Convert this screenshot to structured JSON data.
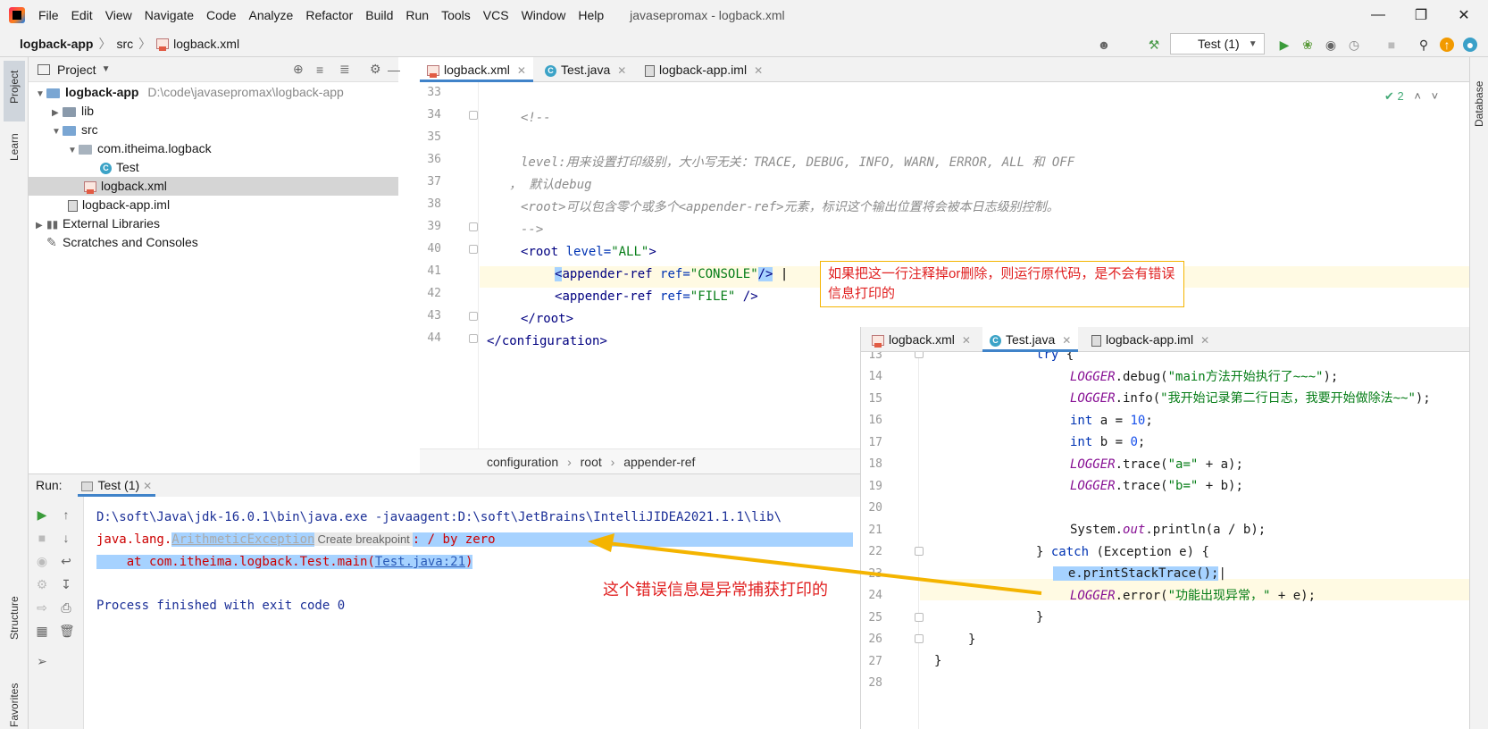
{
  "menubar": {
    "items": [
      "File",
      "Edit",
      "View",
      "Navigate",
      "Code",
      "Analyze",
      "Refactor",
      "Build",
      "Run",
      "Tools",
      "VCS",
      "Window",
      "Help"
    ],
    "title": "javasepromax - logback.xml"
  },
  "navbar": {
    "crumbs": [
      "logback-app",
      "src",
      "logback.xml"
    ],
    "run_config": "Test (1)"
  },
  "left_strip": {
    "project": "Project",
    "learn": "Learn",
    "structure": "Structure",
    "favorites": "Favorites"
  },
  "right_strip": {
    "database": "Database"
  },
  "project": {
    "header": "Project",
    "tree": [
      {
        "label": "logback-app",
        "path": "D:\\code\\javasepromax\\logback-app"
      },
      {
        "label": "lib"
      },
      {
        "label": "src"
      },
      {
        "label": "com.itheima.logback"
      },
      {
        "label": "Test"
      },
      {
        "label": "logback.xml"
      },
      {
        "label": "logback-app.iml"
      },
      {
        "label": "External Libraries"
      },
      {
        "label": "Scratches and Consoles"
      }
    ]
  },
  "editor": {
    "tabs": [
      "logback.xml",
      "Test.java",
      "logback-app.iml"
    ],
    "line_numbers": [
      "33",
      "34",
      "35",
      "36",
      "37",
      "38",
      "39",
      "40",
      "41",
      "42",
      "43",
      "44"
    ],
    "inspection_count": "2",
    "lines": {
      "l34": "<!--",
      "l36a": "level:",
      "l36b": "用来设置打印级别，大小写无关：TRACE, DEBUG, INFO, WARN, ERROR, ALL 和 OFF",
      "l37": "， 默认debug",
      "l38a": "<root>",
      "l38b": "可以包含零个或多个",
      "l38c": "<appender-ref>",
      "l38d": "元素，标识这个输出位置将会被本日志级别控制。",
      "l39": "-->",
      "l40_tag": "root",
      "l40_attr": "level",
      "l40_val": "\"ALL\"",
      "l41_tag": "appender-ref",
      "l41_attr": "ref",
      "l41_val": "\"CONSOLE\"",
      "l42_tag": "appender-ref",
      "l42_attr": "ref",
      "l42_val": "\"FILE\"",
      "l43_tag": "root",
      "l44_tag": "configuration"
    },
    "breadcrumbs": [
      "configuration",
      "root",
      "appender-ref"
    ]
  },
  "note_box": "如果把这一行注释掉or删除，则运行原代码，是不会有错误信息打印的",
  "run": {
    "label": "Run:",
    "tab": "Test (1)",
    "lines": {
      "cmd": "D:\\soft\\Java\\jdk-16.0.1\\bin\\java.exe -javaagent:D:\\soft\\JetBrains\\IntelliJIDEA2021.1.1\\lib\\",
      "exc_prefix": "java.lang.",
      "exc_class": "ArithmeticException",
      "bp_chip": "Create breakpoint",
      "exc_msg": ": / by zero",
      "at_prefix": "    at com.itheima.logback.Test.main(",
      "at_link": "Test.java:21",
      "at_suffix": ")",
      "finished": "Process finished with exit code 0"
    }
  },
  "arrow_note": "这个错误信息是异常捕获打印的",
  "editor2": {
    "tabs": [
      "logback.xml",
      "Test.java",
      "logback-app.iml"
    ],
    "line_numbers": [
      "13",
      "14",
      "15",
      "16",
      "17",
      "18",
      "19",
      "20",
      "21",
      "22",
      "23",
      "24",
      "25",
      "26",
      "27",
      "28"
    ],
    "lines": {
      "try": "try",
      "logger": "LOGGER",
      "debug_call": ".debug(",
      "debug_str": "\"main方法开始执行了~~~\"",
      "info_call": ".info(",
      "info_str": "\"我开始记录第二行日志，我要开始做除法~~\"",
      "int_kw": "int",
      "a_decl": " a = ",
      "a_val": "10",
      "b_decl": " b = ",
      "b_val": "0",
      "trace_call": ".trace(",
      "trace_a_str": "\"a=\"",
      "trace_a_rest": " + a);",
      "trace_b_str": "\"b=\"",
      "trace_b_rest": " + b);",
      "sys": "System.",
      "out": "out",
      "println": ".println(a / b);",
      "catch_kw": "catch",
      "catch_rest": " (Exception e) {",
      "print_trace": "e.printStackTrace();",
      "error_call": ".error(",
      "error_str": "\"功能出现异常，\"",
      "error_rest": " + e);"
    }
  },
  "colors": {
    "accent": "#4083c9",
    "annotation": "#e02020",
    "arrow": "#f4b400",
    "selection": "#a6d2ff"
  }
}
